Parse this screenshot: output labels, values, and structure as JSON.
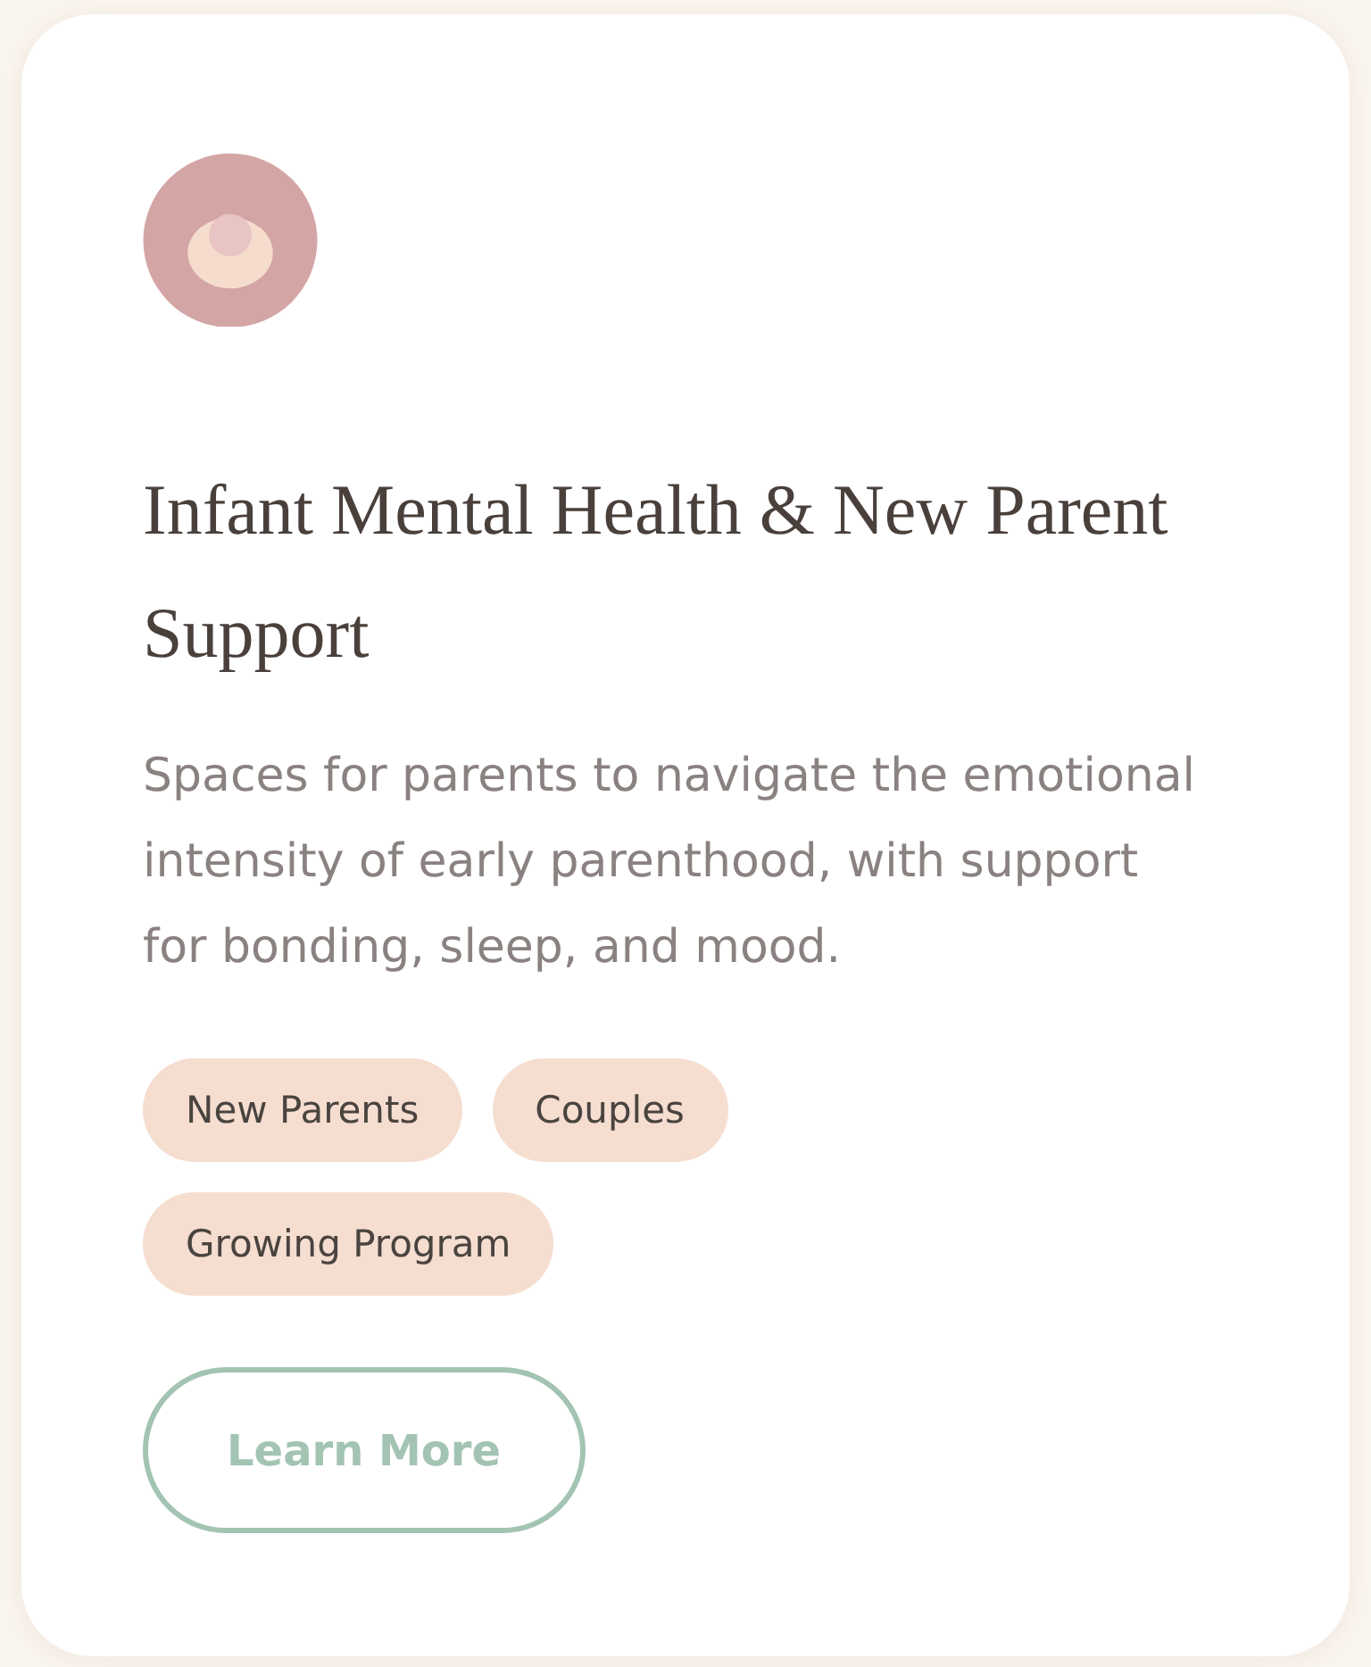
{
  "card": {
    "title": "Infant Mental Health & New Parent Support",
    "description": "Spaces for parents to navigate the emotional intensity of early parenthood, with support for bonding, sleep, and mood.",
    "tags": [
      "New Parents",
      "Couples",
      "Growing Program"
    ],
    "button": {
      "label": "Learn More"
    }
  }
}
